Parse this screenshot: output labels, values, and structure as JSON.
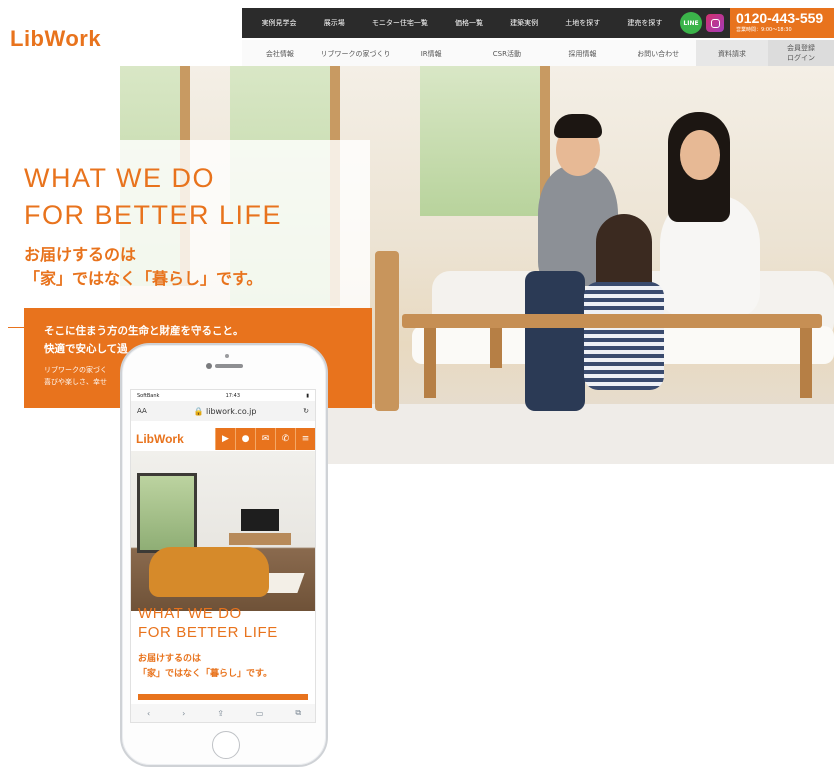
{
  "desktop": {
    "logo": "LibWork",
    "top_nav": [
      "実例見学会",
      "展示場",
      "モニター住宅一覧",
      "価格一覧",
      "建築実例",
      "土地を探す",
      "建売を探す"
    ],
    "line_label": "LINE",
    "phone_number": "0120-443-559",
    "phone_hours": "営業時間：9:00～18:30",
    "sub_nav": [
      "会社情報",
      "リブワークの家づくり",
      "IR情報",
      "CSR活動",
      "採用情報",
      "お問い合わせ"
    ],
    "request_label": "資料請求",
    "member_label_1": "会員登録",
    "member_label_2": "ログイン",
    "hero": {
      "headline_1": "WHAT WE DO",
      "headline_2": "FOR BETTER LIFE",
      "sub_1": "お届けするのは",
      "sub_2": "「家」ではなく「暮らし」です。",
      "box_line_1": "そこに住まう方の生命と財産を守ること。",
      "box_line_2": "快適で安心して過",
      "box_small_1": "リブワークの家づく",
      "box_small_2": "喜びや楽しさ、幸せ"
    }
  },
  "mobile": {
    "status_carrier": "SoftBank",
    "status_time": "17:43",
    "url_aa": "AA",
    "url": "libwork.co.jp",
    "logo": "LibWork",
    "icons": [
      "youtube-icon",
      "chat-icon",
      "mail-icon",
      "phone-icon",
      "menu-icon"
    ],
    "headline_1": "WHAT WE DO",
    "headline_2": "FOR BETTER LIFE",
    "sub_1": "お届けするのは",
    "sub_2": "「家」ではなく「暮らし」です。"
  },
  "colors": {
    "accent": "#e8731d",
    "topbar": "#2b2b2b",
    "line_green": "#3bb44a"
  }
}
